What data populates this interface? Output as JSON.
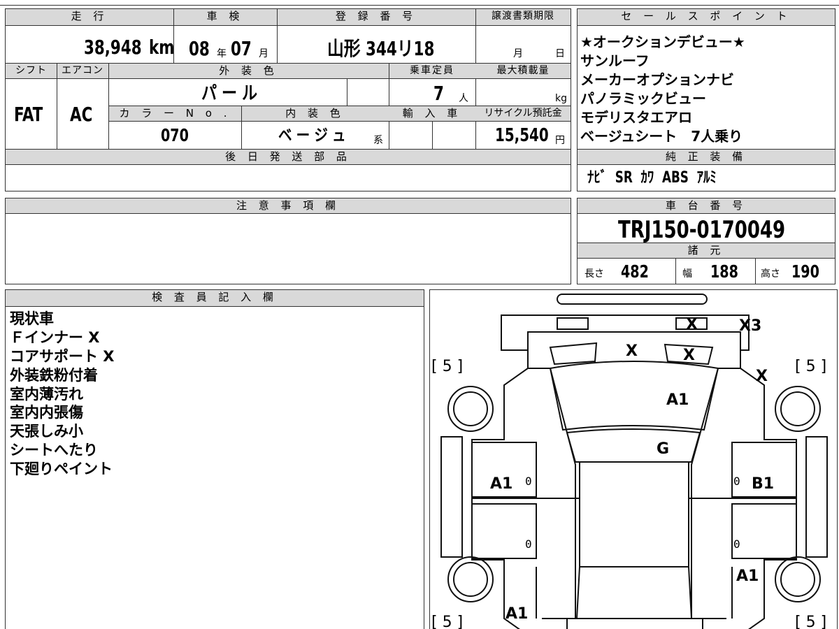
{
  "mileage": {
    "label": "走 行",
    "value": "38,948",
    "unit": "km"
  },
  "inspection": {
    "label": "車 検",
    "year": "08",
    "year_unit": "年",
    "month": "07",
    "month_unit": "月"
  },
  "registration": {
    "label": "登 録 番 号",
    "value": "山形 344リ18"
  },
  "transfer": {
    "label": "譲渡書類期限",
    "month_unit": "月",
    "day_unit": "日"
  },
  "sales_points": {
    "label": "セ ー ル ス ポ イ ン ト",
    "items": [
      "★オークションデビュー★",
      "サンルーフ",
      "メーカーオプションナビ",
      "パノラミックビュー",
      "モデリスタエアロ",
      "ベージュシート　7人乗り"
    ]
  },
  "shift": {
    "label": "シフト",
    "value": "FAT"
  },
  "aircon": {
    "label": "エアコン",
    "value": "AC"
  },
  "exterior_color": {
    "label": "外 装 色",
    "value": "パ ー ル"
  },
  "capacity": {
    "label": "乗車定員",
    "value": "7",
    "unit": "人"
  },
  "max_load": {
    "label": "最大積載量",
    "unit": "kg"
  },
  "color_no": {
    "label": "カ ラ ー N o .",
    "value": "070"
  },
  "interior_color": {
    "label": "内 装 色",
    "value": "ベ ー ジ ュ",
    "suffix": "系"
  },
  "import": {
    "label": "輸 入 車"
  },
  "recycle": {
    "label": "リサイクル預託金",
    "value": "15,540",
    "unit": "円"
  },
  "later_parts": {
    "label": "後 日 発 送 部 品"
  },
  "genuine": {
    "label": "純 正 装 備",
    "value": "ﾅﾋﾞ  SR  ｶﾜ  ABS  ｱﾙﾐ"
  },
  "notes": {
    "label": "注 意 事 項 欄"
  },
  "chassis": {
    "label": "車 台 番 号",
    "value": "TRJ150-0170049"
  },
  "specs": {
    "label": "諸 元",
    "length_label": "長さ",
    "length": "482",
    "width_label": "幅",
    "width": "188",
    "height_label": "高さ",
    "height": "190"
  },
  "inspector": {
    "label": "検 査 員 記 入 欄",
    "items": [
      "現状車",
      "Ｆインナー X",
      "コアサポート X",
      "外装鉄粉付着",
      "室内薄汚れ",
      "室内内張傷",
      "天張しみ小",
      "シートへたり",
      "下廻りペイント"
    ]
  },
  "diagram": {
    "marks": [
      "X",
      "X3",
      "X",
      "X",
      "X",
      "A1",
      "G",
      "A1",
      "B1",
      "A1",
      "A1"
    ],
    "tires": [
      "[ 5 ]",
      "[ 5 ]",
      "[ 5 ]",
      "[ 5 ]"
    ],
    "zeros": [
      "0",
      "0",
      "0",
      "0"
    ]
  }
}
